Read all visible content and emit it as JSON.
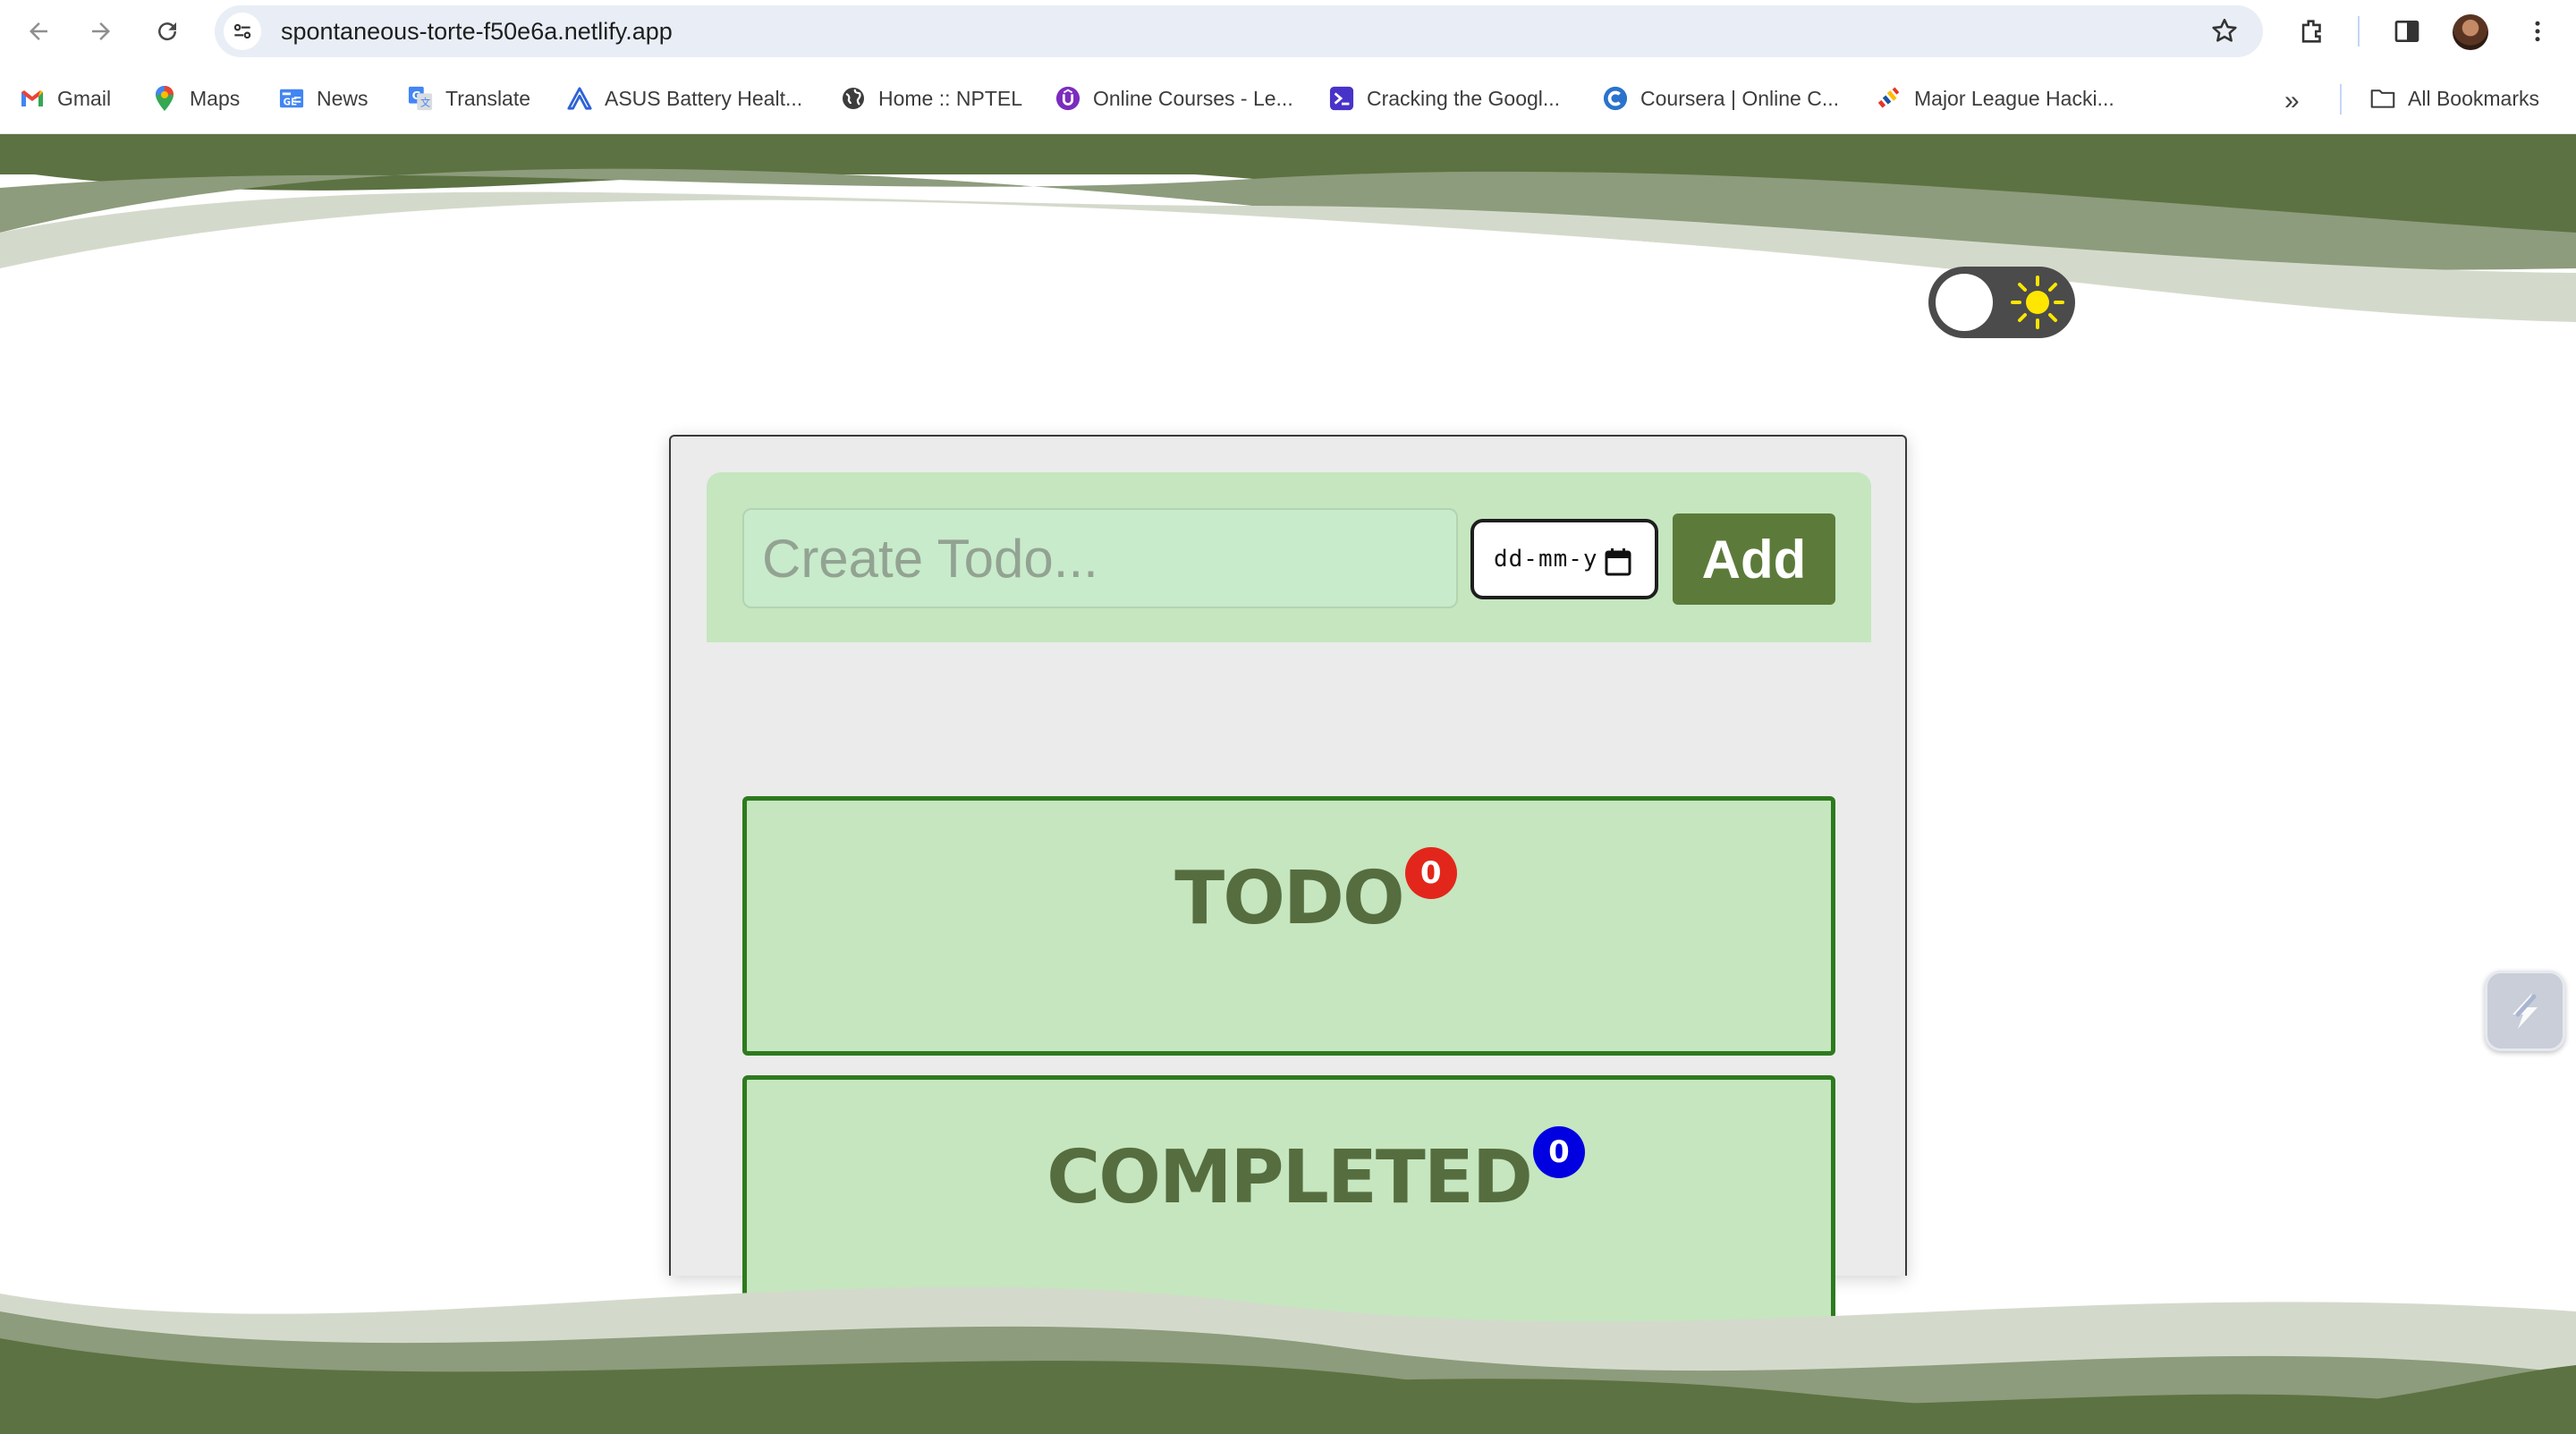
{
  "browser": {
    "url": "spontaneous-torte-f50e6a.netlify.app",
    "nav_icons": [
      "back-arrow-icon",
      "forward-arrow-icon",
      "reload-icon"
    ],
    "right_icons": [
      "bookmark-star-icon",
      "extensions-icon",
      "side-panel-icon",
      "profile-avatar",
      "menu-dots-icon"
    ]
  },
  "bookmarks": {
    "items": [
      {
        "label": "Gmail",
        "icon": "gmail-icon"
      },
      {
        "label": "Maps",
        "icon": "maps-icon"
      },
      {
        "label": "News",
        "icon": "news-icon"
      },
      {
        "label": "Translate",
        "icon": "translate-icon"
      },
      {
        "label": "ASUS Battery Healt...",
        "icon": "asus-icon"
      },
      {
        "label": "Home :: NPTEL",
        "icon": "globe-icon"
      },
      {
        "label": "Online Courses - Le...",
        "icon": "udemy-icon"
      },
      {
        "label": "Cracking the Googl...",
        "icon": "terminal-icon"
      },
      {
        "label": "Coursera | Online C...",
        "icon": "coursera-icon"
      },
      {
        "label": "Major League Hacki...",
        "icon": "mlh-icon"
      }
    ],
    "more": "»",
    "all_bookmarks": "All Bookmarks"
  },
  "app": {
    "theme_toggle": "light",
    "input_placeholder": "Create Todo...",
    "input_value": "",
    "date_placeholder": "dd-mm-y",
    "add_label": "Add",
    "sections": [
      {
        "title": "TODO",
        "count": "0",
        "badge_color": "#e3261b"
      },
      {
        "title": "COMPLETED",
        "count": "0",
        "badge_color": "#0000e0"
      }
    ]
  },
  "colors": {
    "accent_green": "#5c7b3a",
    "wave_dark": "#5c7242",
    "panel_green": "#c5e6bf",
    "border_green": "#2e7a1f"
  }
}
